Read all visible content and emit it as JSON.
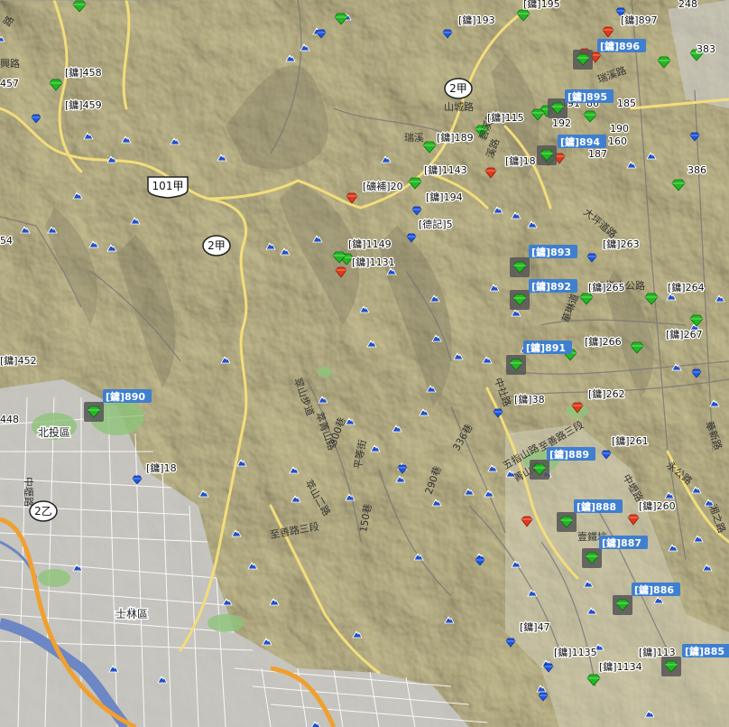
{
  "colors": {
    "terrain": "#d9d3b3",
    "terrain_light": "#e6e1c7",
    "terrain_dark": "#a9a38a",
    "urban": "#c9c9c9",
    "river": "#6d86c4",
    "highway": "#f0a030",
    "road": "#f3dd7a",
    "peak_icon": "#1f4fc9",
    "mine_green": "#22b822",
    "mine_red": "#e03a1a",
    "mine_blue": "#1d57e8",
    "selected_label_bg": "#3f7fd0"
  },
  "highway_shields": [
    {
      "id": "101a",
      "text": "101甲"
    },
    {
      "id": "2a_top",
      "text": "2甲"
    },
    {
      "id": "2a_mid",
      "text": "2甲"
    },
    {
      "id": "2b",
      "text": "2乙"
    }
  ],
  "place_labels": [
    {
      "id": "shilin",
      "text": "士林區"
    },
    {
      "id": "beitou",
      "text": "北投區"
    }
  ],
  "road_labels": [
    {
      "id": "r1",
      "text": "路"
    },
    {
      "id": "r2",
      "text": "興路"
    },
    {
      "id": "r3",
      "text": "山城路"
    },
    {
      "id": "r4",
      "text": "瑞溪"
    },
    {
      "id": "r5",
      "text": "瑞溪路"
    },
    {
      "id": "r6",
      "text": "大坪道路"
    },
    {
      "id": "r7",
      "text": "五指山公路"
    },
    {
      "id": "r8",
      "text": "五指山路"
    },
    {
      "id": "r9",
      "text": "華新路"
    },
    {
      "id": "r10",
      "text": "翠山步道"
    },
    {
      "id": "r11",
      "text": "萃菁山路"
    },
    {
      "id": "r12",
      "text": "萃山二路"
    },
    {
      "id": "r13",
      "text": "至善路三段"
    },
    {
      "id": "r14",
      "text": "150巷"
    },
    {
      "id": "r15",
      "text": "336巷"
    },
    {
      "id": "r16",
      "text": "290巷"
    },
    {
      "id": "r17",
      "text": "中社路"
    },
    {
      "id": "r18",
      "text": "菁山路"
    },
    {
      "id": "r19",
      "text": "永公路"
    },
    {
      "id": "r20",
      "text": "平等街"
    },
    {
      "id": "r21",
      "text": "300巷"
    },
    {
      "id": "r22",
      "text": "溪路"
    },
    {
      "id": "r23",
      "text": "碧溪路"
    },
    {
      "id": "r24",
      "text": "華琳道"
    },
    {
      "id": "r25",
      "text": "中壢路"
    },
    {
      "id": "r26",
      "text": "湘之路"
    },
    {
      "id": "r27",
      "text": "壹鐵坑"
    },
    {
      "id": "r28",
      "text": "中壢路"
    },
    {
      "id": "r29",
      "text": "至善路三段"
    }
  ],
  "mine_labels": [
    {
      "id": "m193",
      "text": "[鏞]193"
    },
    {
      "id": "m195",
      "text": "[鏞]195"
    },
    {
      "id": "m897",
      "text": "[鏞]897"
    },
    {
      "id": "m248",
      "text": "248"
    },
    {
      "id": "m383",
      "text": "383"
    },
    {
      "id": "m458",
      "text": "[鏞]458"
    },
    {
      "id": "m457",
      "text": "457"
    },
    {
      "id": "m459",
      "text": "[鏞]459"
    },
    {
      "id": "m185",
      "text": "185"
    },
    {
      "id": "m191",
      "text": "191"
    },
    {
      "id": "m186",
      "text": "86"
    },
    {
      "id": "m115",
      "text": "[鏞]115"
    },
    {
      "id": "m192",
      "text": "192"
    },
    {
      "id": "m189",
      "text": "[鏞]189"
    },
    {
      "id": "m190",
      "text": "190"
    },
    {
      "id": "m160",
      "text": "160"
    },
    {
      "id": "m187",
      "text": "187"
    },
    {
      "id": "m18x",
      "text": "[鏞]18"
    },
    {
      "id": "m1143",
      "text": "[鏞]1143"
    },
    {
      "id": "m386",
      "text": "386"
    },
    {
      "id": "m20",
      "text": "[礦補]20"
    },
    {
      "id": "m194",
      "text": "[鏞]194"
    },
    {
      "id": "md5",
      "text": "[德記]5"
    },
    {
      "id": "m263",
      "text": "[鏞]263"
    },
    {
      "id": "m54",
      "text": "54"
    },
    {
      "id": "m1149",
      "text": "[鏞]1149"
    },
    {
      "id": "m1131",
      "text": "[鏞]1131"
    },
    {
      "id": "m265",
      "text": "[鏞]265"
    },
    {
      "id": "m264",
      "text": "[鏞]264"
    },
    {
      "id": "m266",
      "text": "[鏞]266"
    },
    {
      "id": "m267",
      "text": "[鏞]267"
    },
    {
      "id": "m452",
      "text": "[鏞]452"
    },
    {
      "id": "m38",
      "text": "[鏞]38"
    },
    {
      "id": "m262",
      "text": "[鏞]262"
    },
    {
      "id": "m448",
      "text": "448"
    },
    {
      "id": "m261",
      "text": "[鏞]261"
    },
    {
      "id": "m18",
      "text": "[鏞]18"
    },
    {
      "id": "m260",
      "text": "[鏞]260"
    },
    {
      "id": "m47",
      "text": "[鏞]47"
    },
    {
      "id": "m1135",
      "text": "[鏞]1135"
    },
    {
      "id": "m1134",
      "text": "[鏞]1134"
    },
    {
      "id": "m113",
      "text": "[鏞]113"
    }
  ],
  "selected_mines": [
    {
      "id": "s896",
      "text": "[鏞]896"
    },
    {
      "id": "s895",
      "text": "[鏞]895"
    },
    {
      "id": "s894",
      "text": "[鏞]894"
    },
    {
      "id": "s893",
      "text": "[鏞]893"
    },
    {
      "id": "s892",
      "text": "[鏞]892"
    },
    {
      "id": "s891",
      "text": "[鏞]891"
    },
    {
      "id": "s890",
      "text": "[鏞]890"
    },
    {
      "id": "s889",
      "text": "[鏞]889"
    },
    {
      "id": "s888",
      "text": "[鏞]888"
    },
    {
      "id": "s887",
      "text": "[鏞]887"
    },
    {
      "id": "s886",
      "text": "[鏞]886"
    },
    {
      "id": "s885",
      "text": "[鏞]885"
    }
  ]
}
